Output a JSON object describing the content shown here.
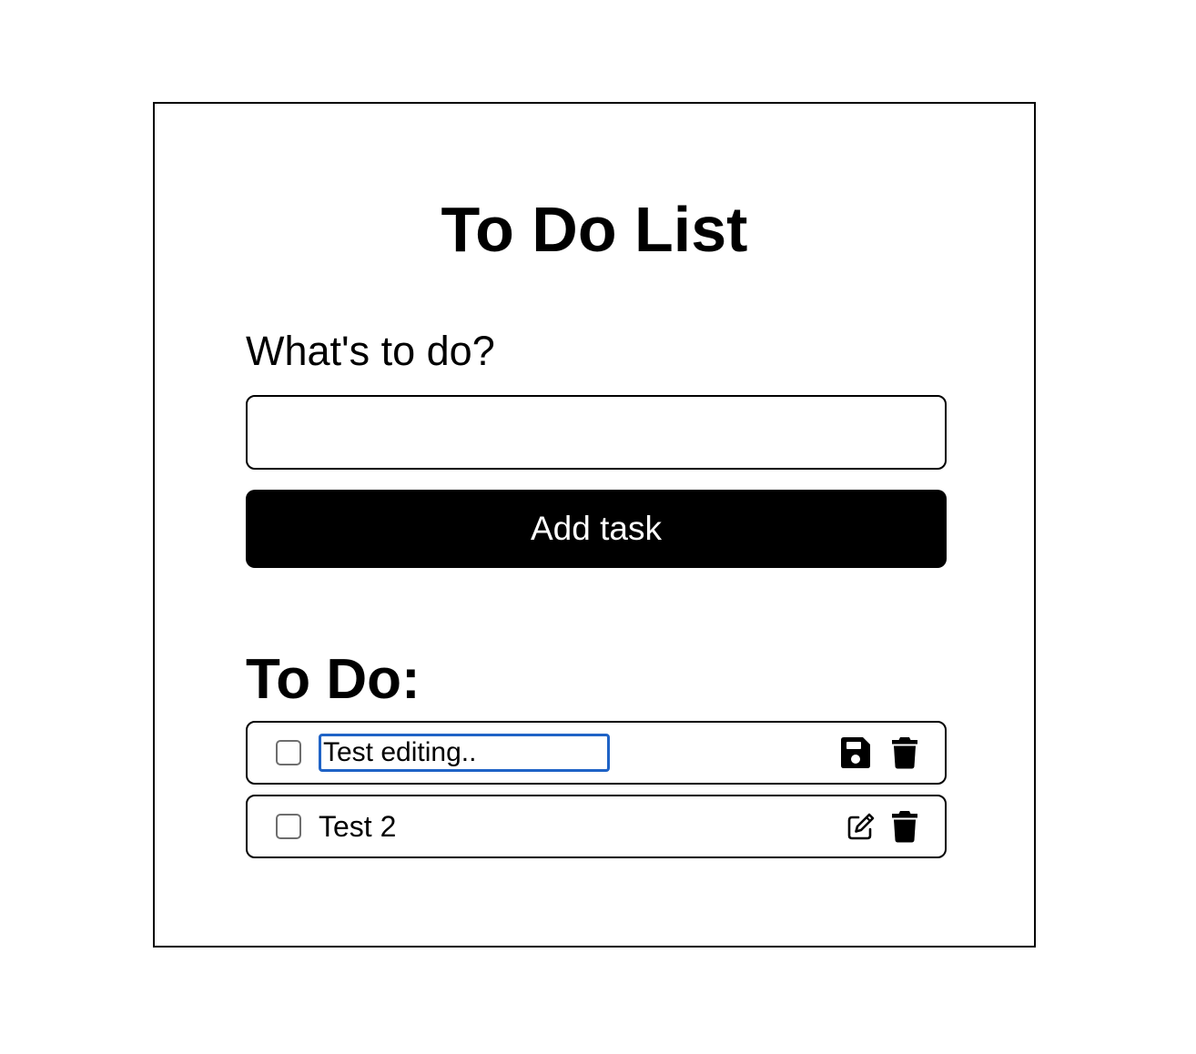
{
  "app": {
    "title": "To Do List"
  },
  "form": {
    "label": "What's to do?",
    "input_value": "",
    "input_placeholder": "",
    "add_button_label": "Add task"
  },
  "todo_section": {
    "heading": "To Do:",
    "tasks": [
      {
        "text": "Test editing..",
        "checked": false,
        "editing": true,
        "actions": [
          "save-icon",
          "trash-icon"
        ]
      },
      {
        "text": "Test 2",
        "checked": false,
        "editing": false,
        "actions": [
          "pen-to-square-icon",
          "trash-icon"
        ]
      }
    ]
  },
  "colors": {
    "accent": "#000000",
    "focus_ring": "#1f63c6",
    "checkbox_border": "#6e6e6e"
  }
}
